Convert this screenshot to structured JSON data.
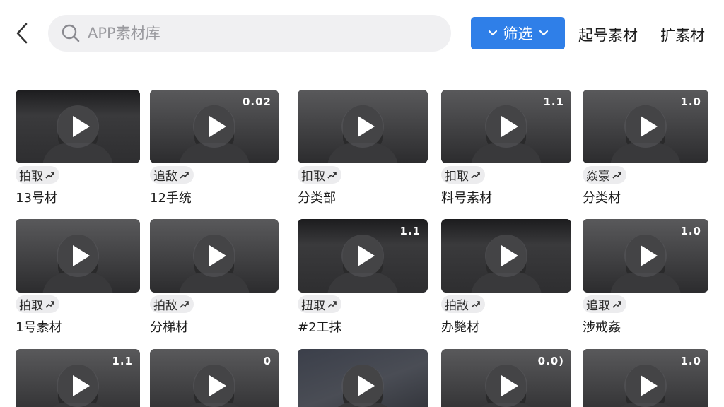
{
  "header": {
    "search_placeholder": "APP素材库",
    "filter_label": "筛选",
    "link_1": "起号素材",
    "link_2": "扩素材"
  },
  "colors": {
    "accent": "#2f7fe8",
    "tag_bg": "#ececee"
  },
  "rows": [
    [
      {
        "duration": "",
        "tag": "拍取",
        "title": "13号材"
      },
      {
        "duration": "0.02",
        "tag": "追敌",
        "title": "12手统"
      },
      {
        "duration": "",
        "tag": "扣取",
        "title": "分类部"
      },
      {
        "duration": "1.1",
        "tag": "扣取",
        "title": "料号素材"
      },
      {
        "duration": "1.0",
        "tag": "焱豪",
        "title": "分类材"
      }
    ],
    [
      {
        "duration": "",
        "tag": "拍取",
        "title": "1号素材"
      },
      {
        "duration": "",
        "tag": "拍敌",
        "title": "分梯材"
      },
      {
        "duration": "1.1",
        "tag": "扭取",
        "title": "#2工抹"
      },
      {
        "duration": "",
        "tag": "拍敌",
        "title": "办斃材"
      },
      {
        "duration": "1.0",
        "tag": "追取",
        "title": "涉戒姦"
      }
    ],
    [
      {
        "duration": "1.1",
        "tag": "",
        "title": ""
      },
      {
        "duration": "0",
        "tag": "",
        "title": ""
      },
      {
        "duration": "",
        "tag": "",
        "title": ""
      },
      {
        "duration": "0.0)",
        "tag": "",
        "title": ""
      },
      {
        "duration": "1.0",
        "tag": "",
        "title": ""
      }
    ]
  ]
}
